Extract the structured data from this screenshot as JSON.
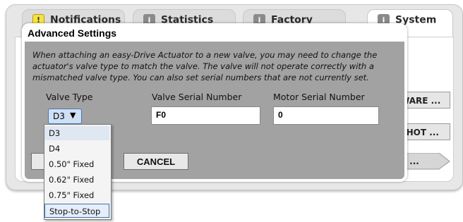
{
  "tabs": [
    {
      "label": "Notifications",
      "icon": "warning-icon"
    },
    {
      "label": "Statistics",
      "icon": "info-icon"
    },
    {
      "label": "Factory Defaults",
      "icon": "info-icon"
    },
    {
      "label": "System",
      "icon": "info-icon"
    }
  ],
  "background_buttons": {
    "firmware": "WARE ...",
    "snapshot": "SHOT ...",
    "arrow": "D ..."
  },
  "modal": {
    "title": "Advanced Settings",
    "description": "When attaching an easy-Drive Actuator to a new valve, you may need to change the actuator's valve type to match the valve. The valve will not operate correctly with a mismatched valve type. You can also set serial numbers that are not currently set.",
    "valve_type_label": "Valve Type",
    "valve_type_value": "D3",
    "valve_serial_label": "Valve Serial Number",
    "valve_serial_value": "F0",
    "motor_serial_label": "Motor Serial Number",
    "motor_serial_value": "0",
    "cancel_label": "CANCEL"
  },
  "valve_type_options": [
    "D3",
    "D4",
    "0.50\" Fixed",
    "0.62\" Fixed",
    "0.75\" Fixed",
    "Stop-to-Stop"
  ],
  "colors": {
    "modal_background": "#a2a2a2",
    "select_highlight": "#cfe0f5",
    "warning_icon": "#f4e442"
  }
}
